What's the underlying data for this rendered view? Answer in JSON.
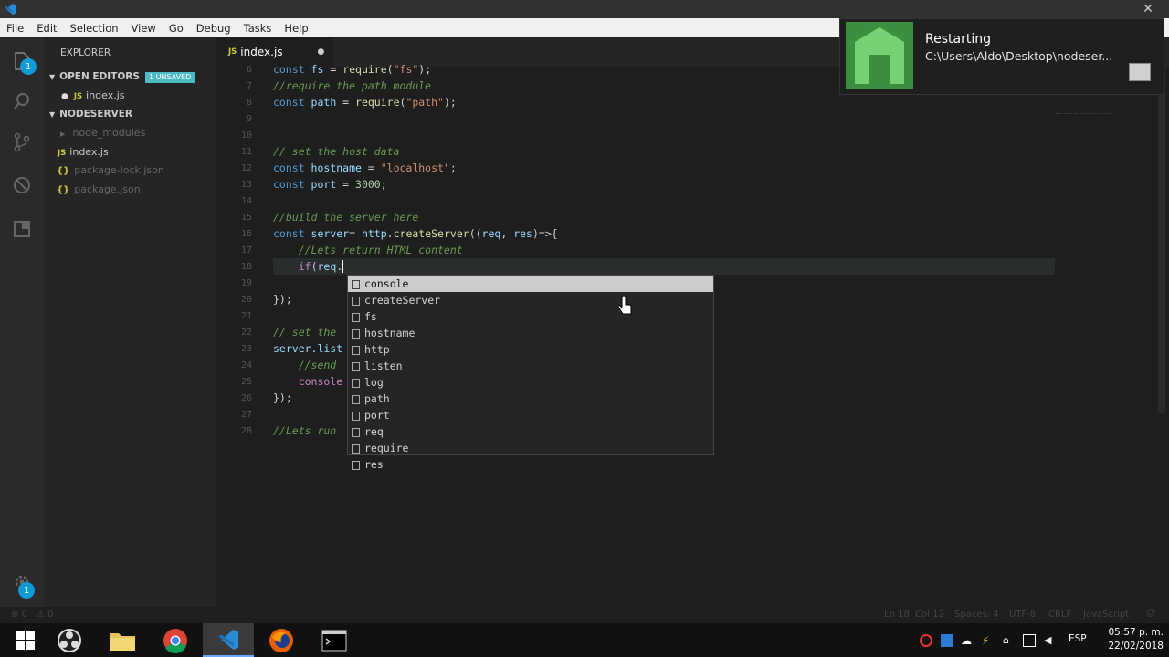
{
  "menu": [
    "File",
    "Edit",
    "Selection",
    "View",
    "Go",
    "Debug",
    "Tasks",
    "Help"
  ],
  "activity": {
    "badge_top": "1",
    "badge_bottom": "1"
  },
  "sidebar": {
    "title": "EXPLORER",
    "open_editors": "OPEN EDITORS",
    "unsaved": "1 UNSAVED",
    "open_file": "index.js",
    "project": "NODESERVER",
    "files": [
      "node_modules",
      "index.js",
      "package-lock.json",
      "package.json"
    ]
  },
  "tab": {
    "label": "index.js",
    "dirty_dot": "●"
  },
  "editor": {
    "line_numbers": [
      "6",
      "7",
      "8",
      "9",
      "10",
      "11",
      "12",
      "13",
      "14",
      "15",
      "16",
      "17",
      "18",
      "19",
      "20",
      "21",
      "22",
      "23",
      "24",
      "25",
      "26",
      "27",
      "28"
    ],
    "lines": [
      "const fs = require(\"fs\");",
      "//require the path module",
      "const path = require(\"path\");",
      "",
      "",
      "// set the host data",
      "const hostname = \"localhost\";",
      "const port = 3000;",
      "",
      "//build the server here",
      "const server= http.createServer((req, res)=>{",
      "    //Lets return HTML content",
      "    if(req.",
      "",
      "});",
      "",
      "// set the",
      "server.list",
      "    //send",
      "    console",
      "});",
      "",
      "//Lets run"
    ]
  },
  "suggest": [
    "console",
    "createServer",
    "fs",
    "hostname",
    "http",
    "listen",
    "log",
    "path",
    "port",
    "req",
    "require",
    "res"
  ],
  "notification": {
    "title": "Restarting",
    "body": "C:\\Users\\Aldo\\Desktop\\nodeser..."
  },
  "status": {
    "errors": "⊗ 0",
    "warnings": "⚠ 0",
    "position": "Ln 18, Col 12",
    "spaces": "Spaces: 4",
    "encoding": "UTF-8",
    "eol": "CRLF",
    "language": "JavaScript"
  },
  "taskbar": {
    "lang": "ESP",
    "time": "05:57 p. m.",
    "date": "22/02/2018"
  },
  "colors": {
    "accent": "#0e9ad4",
    "node_green": "#3c8f3e",
    "unsaved_badge": "#4db9c3"
  }
}
